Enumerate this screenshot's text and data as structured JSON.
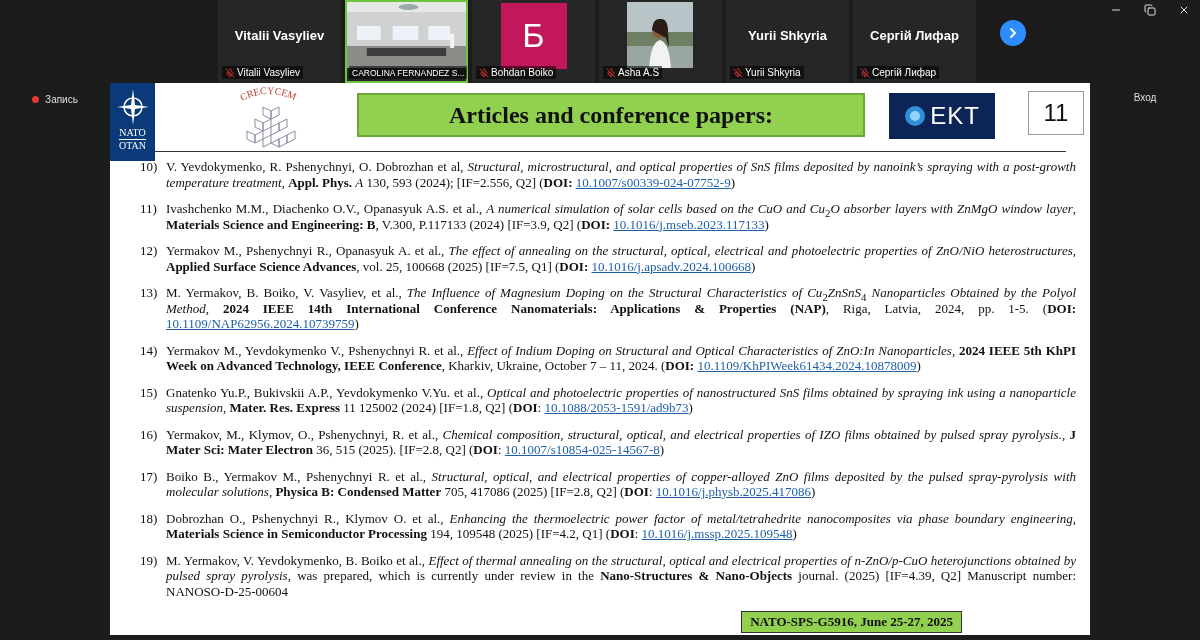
{
  "participants": [
    {
      "kind": "name",
      "name": "Vitalii Vasyliev",
      "label": "Vitalii Vasyliev",
      "muted": true,
      "speaking": false
    },
    {
      "kind": "video",
      "label": "CAROLINA FERNANDEZ S...",
      "muted": false,
      "speaking": true
    },
    {
      "kind": "avatar",
      "initial": "Б",
      "color": "#c2185b",
      "label": "Bohdan Boiko",
      "muted": true,
      "speaking": false
    },
    {
      "label": "Asha A.S",
      "muted": true,
      "speaking": false
    },
    {
      "kind": "name",
      "name": "Yurii Shkyria",
      "label": "Yurii Shkyria",
      "muted": true,
      "speaking": false
    },
    {
      "kind": "name",
      "name": "Сергій Лифар",
      "label": "Сергій Лифар",
      "muted": true,
      "speaking": false
    }
  ],
  "recording": {
    "label": "Запись",
    "on": true
  },
  "login": "Вход",
  "slide": {
    "nato_logo": {
      "top": "NATO",
      "bottom": "OTAN"
    },
    "project_logo": "CRECYCEM",
    "title": "Articles and conference papers:",
    "partner_logo": "EKT",
    "page": "11",
    "references": [
      {
        "number": "10)",
        "text": "V. Yevdokymenko, R. Pshenychnyi, O. Dobrozhan et al, *Structural, microstructural, and optical properties of SnS films deposited by nanoink’s spraying with a post-growth temperature treatment*, **Appl. Phys.** *A* 130, 593 (2024); [IF=2.556, Q2] (**DOI:** ",
        "doi": "10.1007/s00339-024-07752-9",
        "after": ")"
      },
      {
        "number": "11)",
        "text": "Ivashchenko M.M., Diachenko O.V., Opanasyuk A.S. et al., *A numerical simulation of solar cells based on the CuO and Cu*$_{2}$*O absorber layers with ZnMgO window layer*, **Materials Science and Engineering: B**, V.300,  P.117133 (2024) [IF=3.9, Q2] (**DOI:** ",
        "doi": "10.1016/j.mseb.2023.117133",
        "after": ")"
      },
      {
        "number": "12)",
        "text": "Yermakov M., Pshenychnyi R., Opanasyuk A. et al., *The effect of annealing on the structural, optical, electrical and photoelectric properties of ZnO/NiO heterostructures*, **Applied Surface Science Advances**, vol. 25, 100668 (2025) [IF=7.5, Q1] (**DOI:** ",
        "doi": "10.1016/j.apsadv.2024.100668",
        "after": ")"
      },
      {
        "number": "13)",
        "text": "M. Yermakov, B. Boiko, V. Vasyliev, et al., *The Influence of Magnesium Doping on the Structural Characteristics of Cu*$_{2}$*ZnSnS*$_{4}$ *Nanoparticles Obtained by the Polyol Method*, **2024 IEEE 14th International Conference Nanomaterials: Applications & Properties (NAP)**, Riga, Latvia, 2024, pp. 1-5. (**DOI:** ",
        "doi": "10.1109/NAP62956.2024.10739759",
        "after": ")"
      },
      {
        "number": "14)",
        "text": "Yermakov M., Yevdokymenko V., Pshenychnyi R. et al., *Effect of Indium Doping on Structural and Optical Characteristics of ZnO:In Nanoparticles*, **2024 IEEE 5th KhPI Week on Advanced Technology, IEEE Conference**, Kharkiv, Ukraine, October 7 – 11, 2024. (**DOI:** ",
        "doi": "10.1109/KhPIWeek61434.2024.10878009",
        "after": ")"
      },
      {
        "number": "15)",
        "text": "Gnatenko Yu.P., Bukivskii A.P., Yevdokymenko V.Yu. et al., *Optical and photoelectric properties of nanostructured SnS films obtained by spraying ink using a nanoparticle suspension*, **Mater. Res. Express** 11 125002 (2024) [IF=1.8, Q2] (**DOI**: ",
        "doi": "10.1088/2053-1591/ad9b73",
        "after": ")"
      },
      {
        "number": "16)",
        "text": "Yermakov, M., Klymov, O., Pshenychnyi, R. et al., *Chemical composition, structural, optical, and electrical properties of IZO films obtained by pulsed spray pyrolysis.*, **J Mater Sci: Mater Electron** 36, 515 (2025). [IF=2.8, Q2] (**DOI**: ",
        "doi": "10.1007/s10854-025-14567-8",
        "after": ")"
      },
      {
        "number": "17)",
        "text": "Boiko B., Yermakov M., Pshenychnyi R. et al., *Structural, optical, and electrical properties of copper-alloyed ZnO films deposited by the pulsed spray-pyrolysis with molecular solutions*, **Physica B: Condensed Matter** 705, 417086 (2025) [IF=2.8, Q2] (**DOI**: ",
        "doi": "10.1016/j.physb.2025.417086",
        "after": ")"
      },
      {
        "number": "18)",
        "text": "Dobrozhan O., Pshenychnyi R., Klymov O. et al., *Enhancing the thermoelectric power factor of metal/tetrahedrite nanocomposites via phase boundary engineering*, **Materials Science in Semiconductor Processing** 194, 109548 (2025) [IF=4.2, Q1] (**DOI**: ",
        "doi": "10.1016/j.mssp.2025.109548",
        "after": ")"
      },
      {
        "number": "19)",
        "text": "M. Yermakov, V. Yevdokymenko, B. Boiko et al., *Effect of thermal annealing on the structural, optical and electrical properties of n-ZnO/p-CuO heterojunctions obtained by pulsed spray pyrolysis*, was prepared, which is currently under review in the **Nano-Structures & Nano-Objects** journal. (2025) [IF=4.39, Q2] Manuscript number: NANOSO-D-25-00604"
      }
    ],
    "footer": "NATO-SPS-G5916, June 25-27, 2025"
  }
}
